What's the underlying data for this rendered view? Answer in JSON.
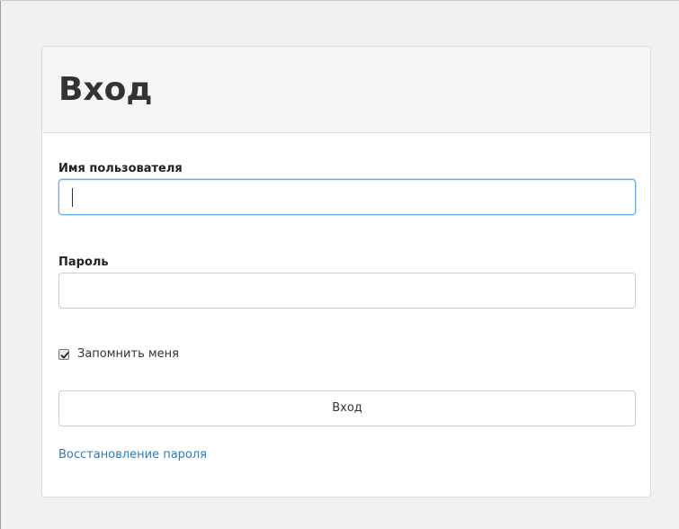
{
  "login": {
    "title": "Вход",
    "username": {
      "label": "Имя пользователя",
      "value": ""
    },
    "password": {
      "label": "Пароль",
      "value": ""
    },
    "remember": {
      "label": "Запомнить меня",
      "checked": true
    },
    "submit_label": "Вход",
    "forgot_link": "Восстановление пароля"
  },
  "colors": {
    "link": "#337ab7",
    "focus_border": "#66afe9",
    "heading_bg": "#f5f5f5"
  }
}
